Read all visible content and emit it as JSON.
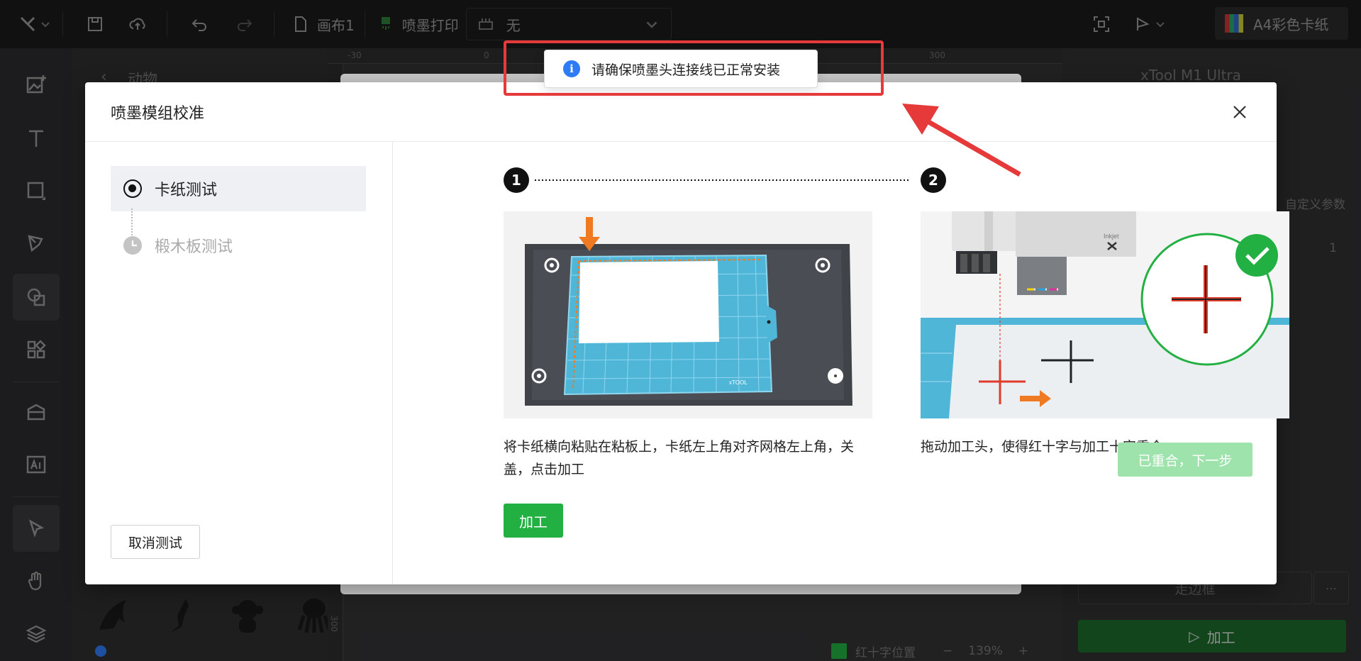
{
  "topbar": {
    "canvas_name": "画布1",
    "mode_label": "喷墨打印",
    "select_value": "无",
    "material": "A4彩色卡纸"
  },
  "library": {
    "title": "动物",
    "back": "‹"
  },
  "right_panel": {
    "device": "xTool M1 Ultra",
    "param_label": "自定义参数",
    "param_value": "1",
    "frame_label": "走边框",
    "run_label": "加工"
  },
  "status": {
    "crosshair_label": "红十字位置",
    "zoom": "139%"
  },
  "ruler": {
    "ticks": [
      "-30",
      "0",
      "300"
    ],
    "v_tick": "300"
  },
  "dialog": {
    "title": "喷墨模组校准",
    "steps": [
      {
        "label": "卡纸测试",
        "state": "active"
      },
      {
        "label": "椴木板测试",
        "state": "pending"
      }
    ],
    "cancel_label": "取消测试",
    "stage_numbers": [
      "1",
      "2"
    ],
    "stage1_desc": "将卡纸横向粘贴在粘板上，卡纸左上角对齐网格左上角，关盖，点击加工",
    "stage1_button": "加工",
    "stage2_desc": "拖动加工头，使得红十字与加工十字重合",
    "next_label": "已重合，下一步",
    "illus2_brand": "Inkjet",
    "mat_brand": "xTOOL"
  },
  "toast": {
    "message": "请确保喷墨头连接线已正常安装"
  },
  "colors": {
    "accent_green": "#23b043",
    "disabled_green": "#9ee3ac",
    "info_blue": "#2f7bf5",
    "annotation_red": "#e5393a",
    "mat_blue": "#4fb6d8"
  }
}
